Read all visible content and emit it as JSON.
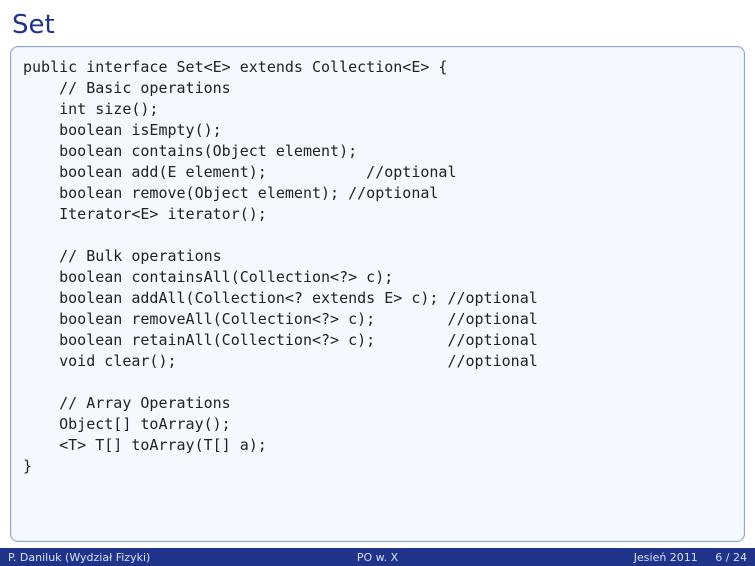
{
  "title": "Set",
  "code": "public interface Set<E> extends Collection<E> {\n    // Basic operations\n    int size();\n    boolean isEmpty();\n    boolean contains(Object element);\n    boolean add(E element);           //optional\n    boolean remove(Object element); //optional\n    Iterator<E> iterator();\n\n    // Bulk operations\n    boolean containsAll(Collection<?> c);\n    boolean addAll(Collection<? extends E> c); //optional\n    boolean removeAll(Collection<?> c);        //optional\n    boolean retainAll(Collection<?> c);        //optional\n    void clear();                              //optional\n\n    // Array Operations\n    Object[] toArray();\n    <T> T[] toArray(T[] a);\n}",
  "footer": {
    "author": "P. Daniluk (Wydział Fizyki)",
    "course": "PO w. X",
    "date": "Jesień 2011",
    "pages": "6 / 24"
  }
}
